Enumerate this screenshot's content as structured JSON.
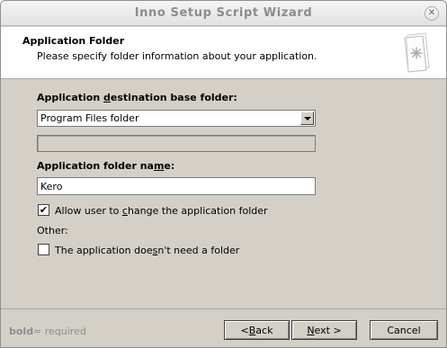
{
  "window": {
    "title": "Inno Setup Script Wizard",
    "close_glyph": "✕"
  },
  "header": {
    "title": "Application Folder",
    "subtitle": "Please specify folder information about your application."
  },
  "form": {
    "dest_label_pre": "Application ",
    "dest_label_accel": "d",
    "dest_label_post": "estination base folder:",
    "dest_selected": "Program Files folder",
    "custom_path_value": "",
    "name_label_pre": "Application folder na",
    "name_label_accel": "m",
    "name_label_post": "e:",
    "name_value": "Kero",
    "allow_change_checked": true,
    "allow_change_check_glyph": "✔",
    "allow_change_pre": "Allow user to ",
    "allow_change_accel": "c",
    "allow_change_post": "hange the application folder",
    "other_label": "Other:",
    "no_folder_checked": false,
    "no_folder_pre": "The application doe",
    "no_folder_accel": "s",
    "no_folder_post": "n't need a folder"
  },
  "footer": {
    "legend_bold": "bold",
    "legend_rest": "= required",
    "back_pre": "< ",
    "back_accel": "B",
    "back_post": "ack",
    "next_accel": "N",
    "next_post": "ext >",
    "cancel_label": "Cancel"
  }
}
